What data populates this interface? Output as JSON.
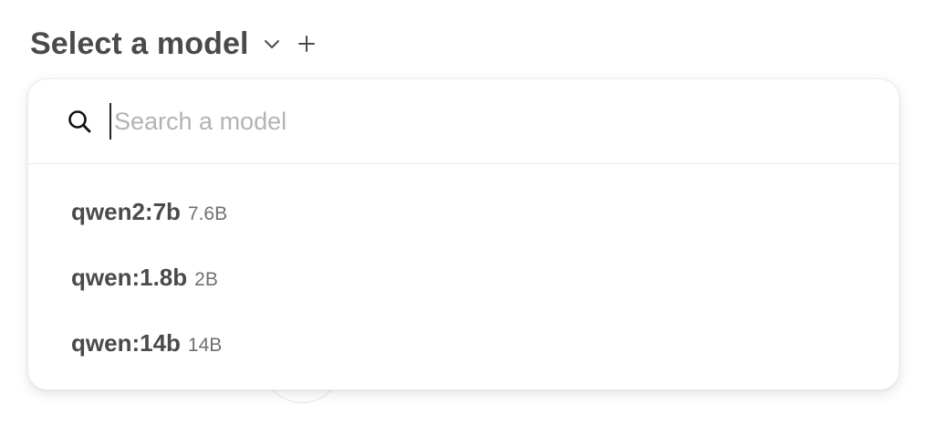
{
  "header": {
    "title": "Select a model"
  },
  "search": {
    "placeholder": "Search a model",
    "value": ""
  },
  "models": [
    {
      "name": "qwen2:7b",
      "size": "7.6B"
    },
    {
      "name": "qwen:1.8b",
      "size": "2B"
    },
    {
      "name": "qwen:14b",
      "size": "14B"
    }
  ],
  "icons": {
    "chevron": "chevron-down-icon",
    "add": "plus-icon",
    "search": "search-icon"
  }
}
